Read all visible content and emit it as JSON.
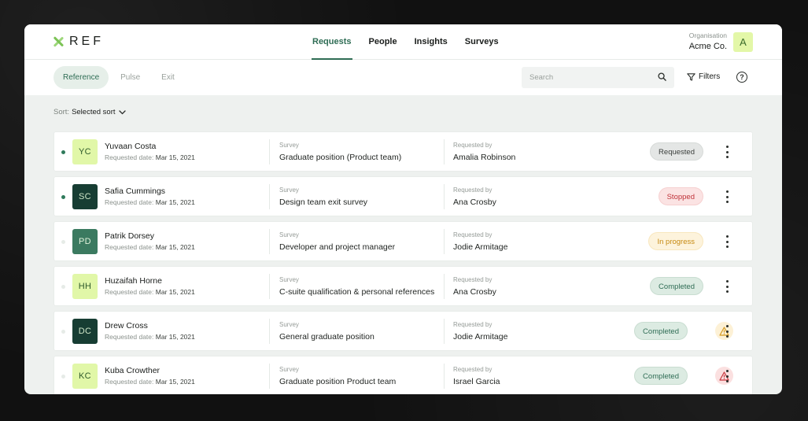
{
  "app": {
    "logo_text": "REF"
  },
  "nav": {
    "items": [
      {
        "label": "Requests",
        "active": true
      },
      {
        "label": "People",
        "active": false
      },
      {
        "label": "Insights",
        "active": false
      },
      {
        "label": "Surveys",
        "active": false
      }
    ]
  },
  "org": {
    "label": "Organisation",
    "name": "Acme Co.",
    "avatar": "A"
  },
  "subtabs": [
    {
      "label": "Reference",
      "active": true
    },
    {
      "label": "Pulse",
      "active": false
    },
    {
      "label": "Exit",
      "active": false
    }
  ],
  "search": {
    "placeholder": "Search",
    "value": ""
  },
  "filters": {
    "label": "Filters"
  },
  "help": {
    "label": "?"
  },
  "sort": {
    "label": "Sort:",
    "value": "Selected sort"
  },
  "labels": {
    "requested_date": "Requested date:",
    "survey": "Survey",
    "requested_by": "Requested by"
  },
  "colors": {
    "accent": "#2f6d55",
    "dot_active": "#2f7a5b",
    "dot_inactive": "#e6ebe7"
  },
  "rows": [
    {
      "initials": "YC",
      "name": "Yuvaan Costa",
      "date": "Mar 15, 2021",
      "survey": "Graduate position (Product team)",
      "requested_by": "Amalia Robinson",
      "status": "Requested",
      "status_bg": "#e4e6e5",
      "status_fg": "#3a3e3b",
      "status_border": "#d7dad8",
      "avatar_bg": "#e1f7a8",
      "avatar_fg": "#2f5a2b",
      "dot": "active",
      "warning": null
    },
    {
      "initials": "SC",
      "name": "Safia Cummings",
      "date": "Mar 15, 2021",
      "survey": "Design team exit survey",
      "requested_by": "Ana Crosby",
      "status": "Stopped",
      "status_bg": "#fbe3e3",
      "status_fg": "#c0333a",
      "status_border": "#f6d0d0",
      "avatar_bg": "#173d33",
      "avatar_fg": "#cfe6c8",
      "dot": "active",
      "warning": null
    },
    {
      "initials": "PD",
      "name": "Patrik Dorsey",
      "date": "Mar 15, 2021",
      "survey": "Developer and project manager",
      "requested_by": "Jodie Armitage",
      "status": "In progress",
      "status_bg": "#fdf3dc",
      "status_fg": "#c68a12",
      "status_border": "#f8e7be",
      "avatar_bg": "#3b7a60",
      "avatar_fg": "#e2f3dc",
      "dot": "inactive",
      "warning": null
    },
    {
      "initials": "HH",
      "name": "Huzaifah Horne",
      "date": "Mar 15, 2021",
      "survey": "C-suite qualification & personal references",
      "requested_by": "Ana Crosby",
      "status": "Completed",
      "status_bg": "#dcebe2",
      "status_fg": "#2f6d55",
      "status_border": "#c9ddd1",
      "avatar_bg": "#e1f7a8",
      "avatar_fg": "#2f5a2b",
      "dot": "inactive",
      "warning": null
    },
    {
      "initials": "DC",
      "name": "Drew Cross",
      "date": "Mar 15, 2021",
      "survey": "General graduate position",
      "requested_by": "Jodie Armitage",
      "status": "Completed",
      "status_bg": "#dcebe2",
      "status_fg": "#2f6d55",
      "status_border": "#c9ddd1",
      "avatar_bg": "#173d33",
      "avatar_fg": "#cfe6c8",
      "dot": "inactive",
      "warning": "caution"
    },
    {
      "initials": "KC",
      "name": "Kuba Crowther",
      "date": "Mar 15, 2021",
      "survey": "Graduate position Product team",
      "requested_by": "Israel Garcia",
      "status": "Completed",
      "status_bg": "#dcebe2",
      "status_fg": "#2f6d55",
      "status_border": "#c9ddd1",
      "avatar_bg": "#e1f7a8",
      "avatar_fg": "#2f5a2b",
      "dot": "inactive",
      "warning": "danger"
    }
  ],
  "icons": {
    "search": "search-icon",
    "filters": "filter-icon",
    "help": "help-icon",
    "sort_chevron": "chevron-down-icon",
    "more": "more-vertical-icon",
    "warning_caution": "warning-icon",
    "warning_danger": "alert-icon"
  }
}
